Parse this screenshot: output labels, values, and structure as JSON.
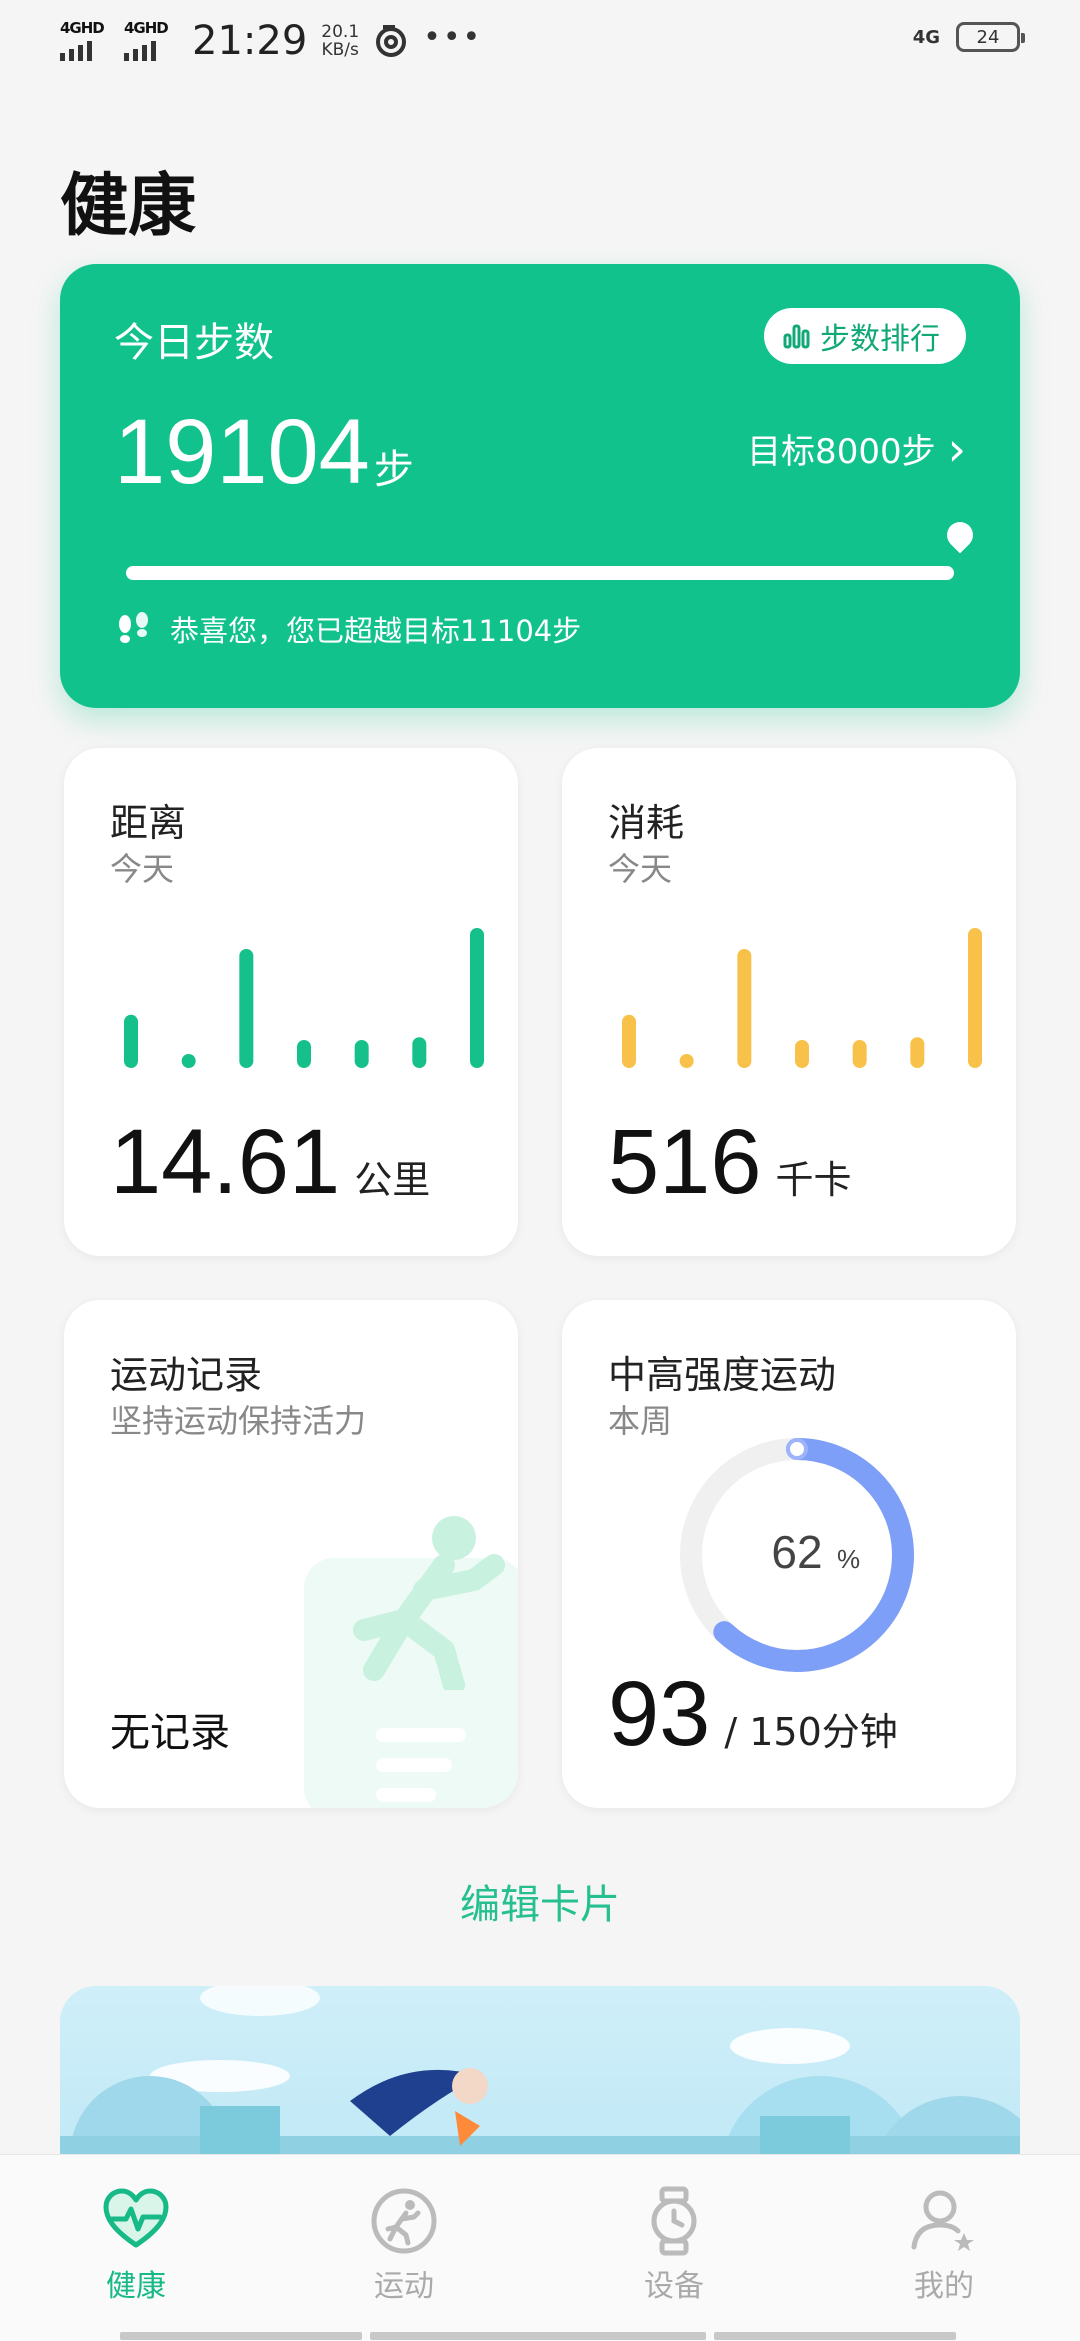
{
  "status_bar": {
    "sim1": "4GHD",
    "sim2": "4GHD",
    "time": "21:29",
    "speed_value": "20.1",
    "speed_unit": "KB/s",
    "more": "•••",
    "network_right": "4G",
    "battery": "24"
  },
  "page": {
    "title": "健康"
  },
  "steps_card": {
    "title": "今日步数",
    "rank_label": "步数排行",
    "steps": "19104",
    "steps_unit": "步",
    "goal": "目标8000步",
    "goal_chevron": "›",
    "progress_percent": 100,
    "congrats": "恭喜您，您已超越目标11104步",
    "colors": {
      "card": "#11c28c"
    }
  },
  "distance_card": {
    "title": "距离",
    "period": "今天",
    "value": "14.61",
    "unit": "公里",
    "bar_color": "#16c08b",
    "bars": [
      0.38,
      0.06,
      0.85,
      0.2,
      0.2,
      0.22,
      1.0
    ]
  },
  "calorie_card": {
    "title": "消耗",
    "period": "今天",
    "value": "516",
    "unit": "千卡",
    "bar_color": "#f8c14a",
    "bars": [
      0.38,
      0.06,
      0.85,
      0.2,
      0.2,
      0.22,
      1.0
    ]
  },
  "workout_card": {
    "title": "运动记录",
    "subtitle": "坚持运动保持活力",
    "status": "无记录"
  },
  "intensity_card": {
    "title": "中高强度运动",
    "period": "本周",
    "percent": "62",
    "percent_sign": "%",
    "percent_value": 62,
    "value": "93",
    "target": "/ 150分钟",
    "ring_color": "#7d9ff8"
  },
  "edit_cards": "编辑卡片",
  "bottom_nav": {
    "items": [
      {
        "label": "健康",
        "icon": "heart-pulse-icon",
        "active": true
      },
      {
        "label": "运动",
        "icon": "running-icon",
        "active": false
      },
      {
        "label": "设备",
        "icon": "watch-icon",
        "active": false
      },
      {
        "label": "我的",
        "icon": "profile-icon",
        "active": false
      }
    ]
  }
}
